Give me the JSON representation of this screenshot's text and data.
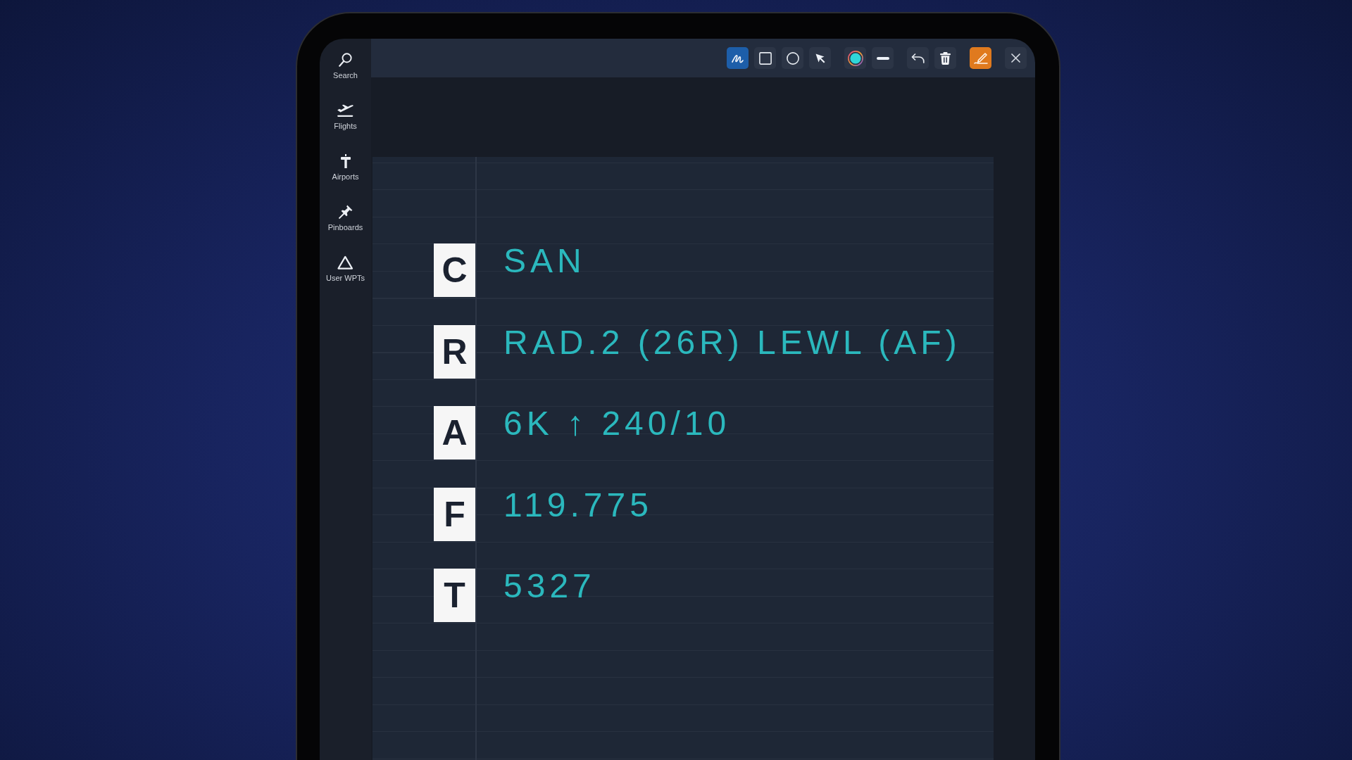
{
  "sidebar": {
    "items": [
      {
        "kind": "search",
        "label": "Search",
        "selected": false
      },
      {
        "kind": "flights",
        "label": "Flights",
        "selected": false
      },
      {
        "kind": "airports",
        "label": "Airports",
        "selected": false
      },
      {
        "kind": "pinboards",
        "label": "Pinboards",
        "selected": false
      },
      {
        "kind": "waypoints",
        "label": "User WPTs",
        "selected": false
      }
    ]
  },
  "toolbar": {
    "tools": [
      {
        "kind": "freehand",
        "selected": true
      },
      {
        "kind": "rectangle",
        "selected": false
      },
      {
        "kind": "ellipse",
        "selected": false
      },
      {
        "kind": "pointer",
        "selected": false
      }
    ],
    "drawing_mode": {
      "on": true
    }
  },
  "notepad": {
    "rows": [
      {
        "letter": "C",
        "note": "SAN"
      },
      {
        "letter": "R",
        "note": "RAD.2 (26R) LEWL (AF)"
      },
      {
        "letter": "A",
        "note": "6K ↑ 240/10"
      },
      {
        "letter": "F",
        "note": "119.775"
      },
      {
        "letter": "T",
        "note": "5327"
      }
    ]
  }
}
